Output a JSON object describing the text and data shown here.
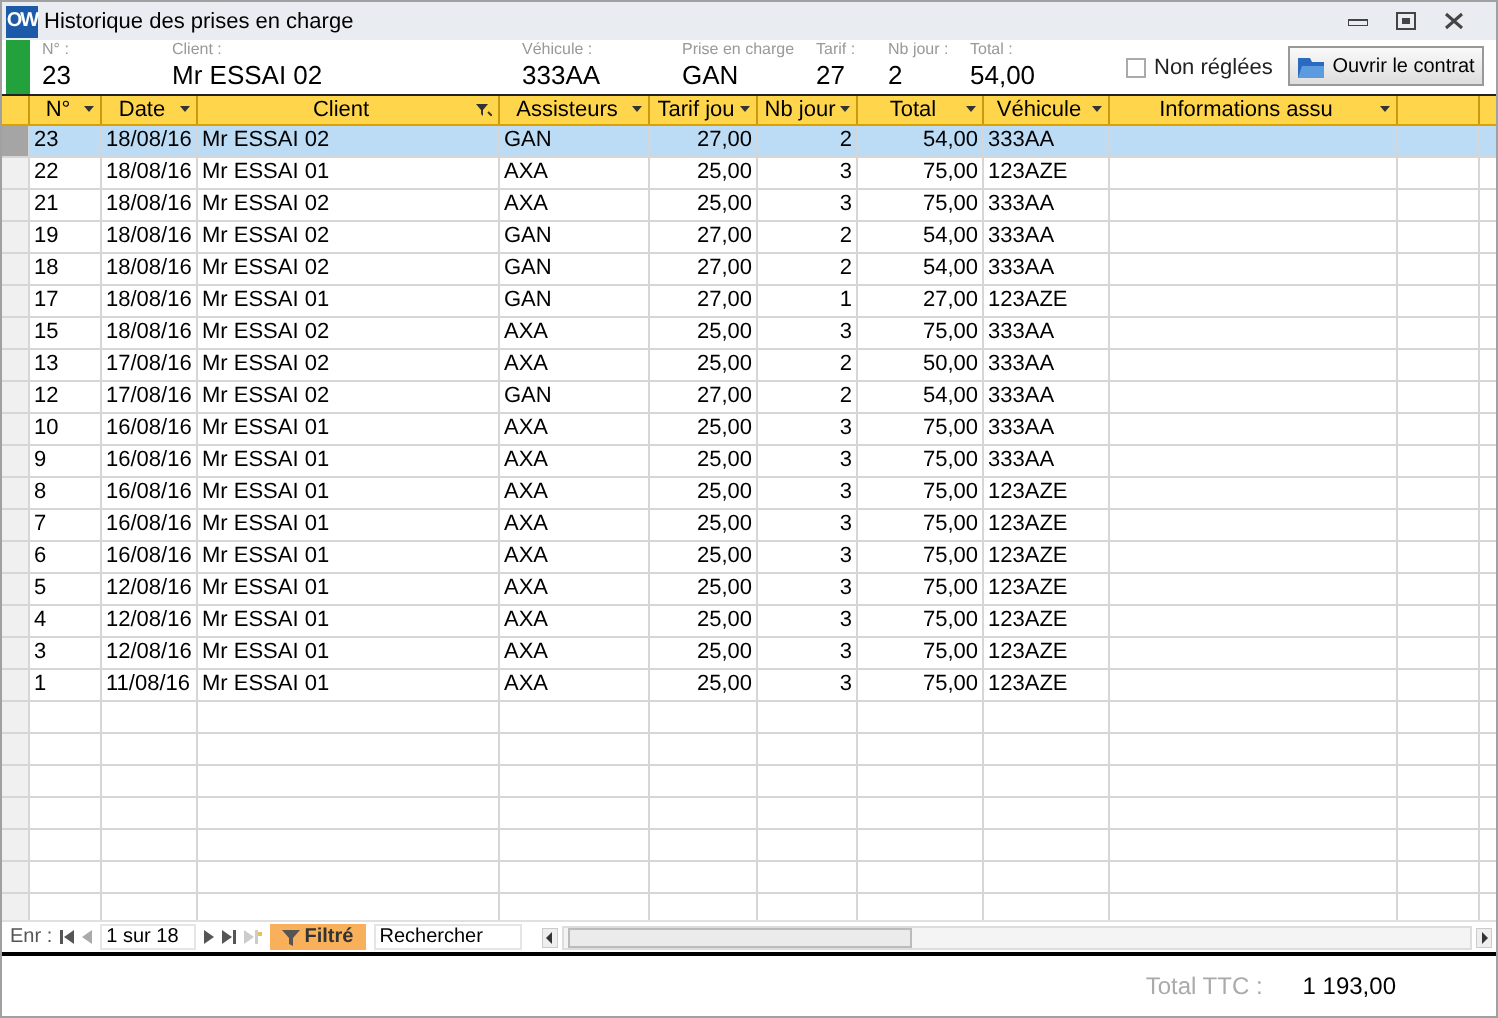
{
  "window": {
    "logo": "OW",
    "title": "Historique des prises en charge"
  },
  "header": {
    "fields": [
      {
        "label": "N° :",
        "value": "23"
      },
      {
        "label": "Client :",
        "value": "Mr ESSAI 02"
      },
      {
        "label": "Véhicule :",
        "value": "333AA"
      },
      {
        "label": "Prise en charge",
        "value": "GAN"
      },
      {
        "label": "Tarif :",
        "value": "27"
      },
      {
        "label": "Nb jour :",
        "value": "2"
      },
      {
        "label": "Total :",
        "value": "54,00"
      }
    ],
    "unpaid": {
      "label": "Non réglées",
      "checked": false
    },
    "open_button": "Ouvrir le contrat"
  },
  "table": {
    "columns": [
      {
        "label": "N°",
        "filtered": false
      },
      {
        "label": "Date",
        "filtered": false
      },
      {
        "label": "Client",
        "filtered": true
      },
      {
        "label": "Assisteurs",
        "filtered": false
      },
      {
        "label": "Tarif jou",
        "filtered": false
      },
      {
        "label": "Nb jour",
        "filtered": false
      },
      {
        "label": "Total",
        "filtered": false
      },
      {
        "label": "Véhicule",
        "filtered": false
      },
      {
        "label": "Informations assu",
        "filtered": false
      }
    ],
    "rows": [
      {
        "cells": [
          "23",
          "18/08/16",
          "Mr ESSAI 02",
          "GAN",
          "27,00",
          "2",
          "54,00",
          "333AA"
        ],
        "selected": true
      },
      {
        "cells": [
          "22",
          "18/08/16",
          "Mr ESSAI 01",
          "AXA",
          "25,00",
          "3",
          "75,00",
          "123AZE"
        ],
        "selected": false
      },
      {
        "cells": [
          "21",
          "18/08/16",
          "Mr ESSAI 02",
          "AXA",
          "25,00",
          "3",
          "75,00",
          "333AA"
        ],
        "selected": false
      },
      {
        "cells": [
          "19",
          "18/08/16",
          "Mr ESSAI 02",
          "GAN",
          "27,00",
          "2",
          "54,00",
          "333AA"
        ],
        "selected": false
      },
      {
        "cells": [
          "18",
          "18/08/16",
          "Mr ESSAI 02",
          "GAN",
          "27,00",
          "2",
          "54,00",
          "333AA"
        ],
        "selected": false
      },
      {
        "cells": [
          "17",
          "18/08/16",
          "Mr ESSAI 01",
          "GAN",
          "27,00",
          "1",
          "27,00",
          "123AZE"
        ],
        "selected": false
      },
      {
        "cells": [
          "15",
          "18/08/16",
          "Mr ESSAI 02",
          "AXA",
          "25,00",
          "3",
          "75,00",
          "333AA"
        ],
        "selected": false
      },
      {
        "cells": [
          "13",
          "17/08/16",
          "Mr ESSAI 02",
          "AXA",
          "25,00",
          "2",
          "50,00",
          "333AA"
        ],
        "selected": false
      },
      {
        "cells": [
          "12",
          "17/08/16",
          "Mr ESSAI 02",
          "GAN",
          "27,00",
          "2",
          "54,00",
          "333AA"
        ],
        "selected": false
      },
      {
        "cells": [
          "10",
          "16/08/16",
          "Mr ESSAI 01",
          "AXA",
          "25,00",
          "3",
          "75,00",
          "333AA"
        ],
        "selected": false
      },
      {
        "cells": [
          "9",
          "16/08/16",
          "Mr ESSAI 01",
          "AXA",
          "25,00",
          "3",
          "75,00",
          "333AA"
        ],
        "selected": false
      },
      {
        "cells": [
          "8",
          "16/08/16",
          "Mr ESSAI 01",
          "AXA",
          "25,00",
          "3",
          "75,00",
          "123AZE"
        ],
        "selected": false
      },
      {
        "cells": [
          "7",
          "16/08/16",
          "Mr ESSAI 01",
          "AXA",
          "25,00",
          "3",
          "75,00",
          "123AZE"
        ],
        "selected": false
      },
      {
        "cells": [
          "6",
          "16/08/16",
          "Mr ESSAI 01",
          "AXA",
          "25,00",
          "3",
          "75,00",
          "123AZE"
        ],
        "selected": false
      },
      {
        "cells": [
          "5",
          "12/08/16",
          "Mr ESSAI 01",
          "AXA",
          "25,00",
          "3",
          "75,00",
          "123AZE"
        ],
        "selected": false
      },
      {
        "cells": [
          "4",
          "12/08/16",
          "Mr ESSAI 01",
          "AXA",
          "25,00",
          "3",
          "75,00",
          "123AZE"
        ],
        "selected": false
      },
      {
        "cells": [
          "3",
          "12/08/16",
          "Mr ESSAI 01",
          "AXA",
          "25,00",
          "3",
          "75,00",
          "123AZE"
        ],
        "selected": false
      },
      {
        "cells": [
          "1",
          "11/08/16",
          "Mr ESSAI 01",
          "AXA",
          "25,00",
          "3",
          "75,00",
          "123AZE"
        ],
        "selected": false
      }
    ]
  },
  "navigation": {
    "label": "Enr :",
    "position": "1 sur 18",
    "filter": {
      "label": "Filtré",
      "on": true
    },
    "search": "Rechercher"
  },
  "footer": {
    "label": "Total TTC :",
    "value": "1 193,00"
  }
}
